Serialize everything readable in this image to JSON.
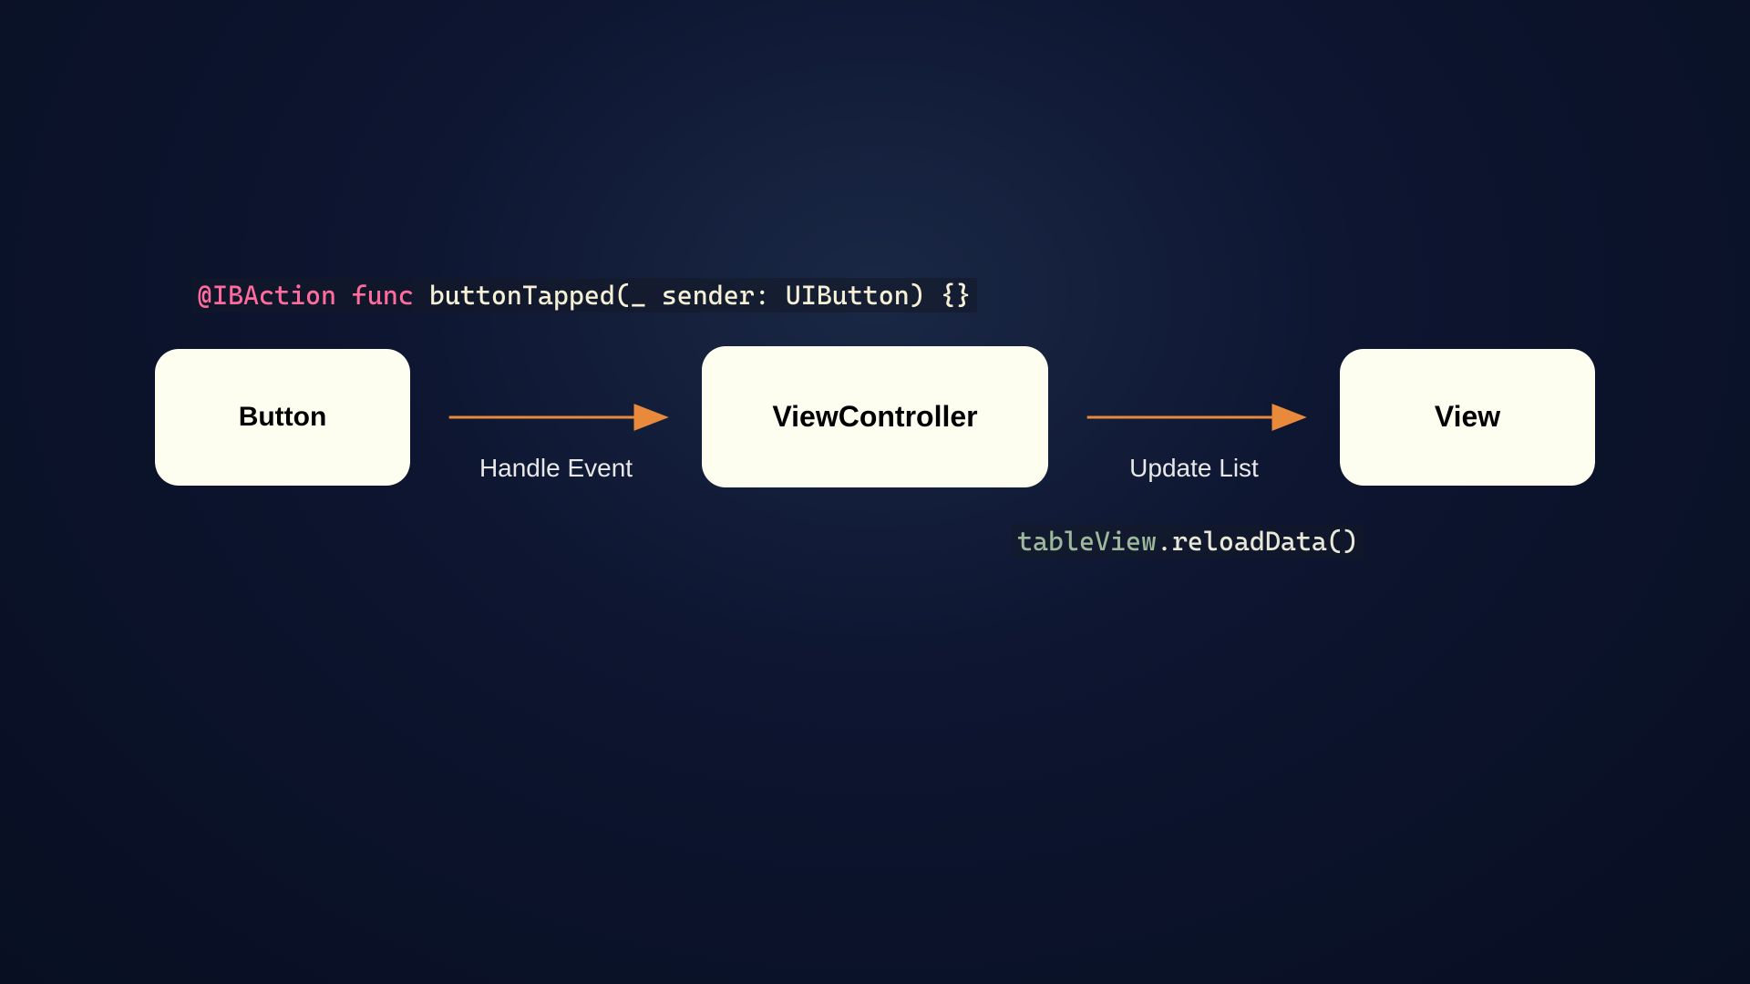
{
  "diagram": {
    "codeTop": {
      "attribute": "@IBAction",
      "keyword": "func",
      "funcName": "buttonTapped",
      "openParen": "(",
      "paramLabel": "_ sender:",
      "paramType": " UIButton",
      "closeParen": ")",
      "braces": " {}"
    },
    "nodes": {
      "button": "Button",
      "viewController": "ViewController",
      "view": "View"
    },
    "arrows": {
      "first": "Handle Event",
      "second": "Update List"
    },
    "codeBottom": {
      "object": "tableView",
      "dot": ".",
      "method": "reloadData",
      "parens": "()"
    },
    "colors": {
      "arrowColor": "#e8893c",
      "nodeBackground": "#fdfdf0"
    }
  }
}
